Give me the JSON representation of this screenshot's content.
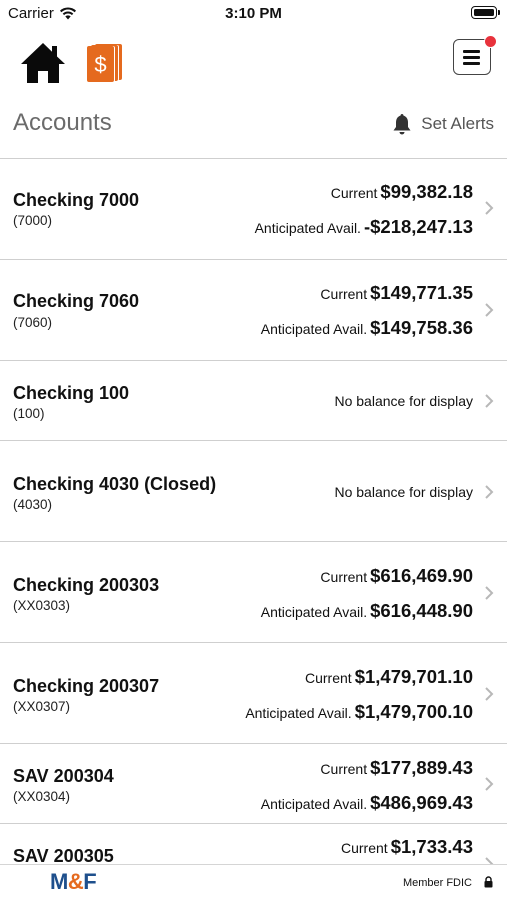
{
  "status_bar": {
    "carrier": "Carrier",
    "time": "3:10 PM"
  },
  "header": {
    "title": "Accounts",
    "set_alerts_label": "Set Alerts"
  },
  "accounts": [
    {
      "name": "Checking 7000",
      "number": "(7000)",
      "current_label": "Current",
      "current_value": "$99,382.18",
      "anticipated_label": "Anticipated Avail.",
      "anticipated_value": "-$218,247.13"
    },
    {
      "name": "Checking 7060",
      "number": "(7060)",
      "current_label": "Current",
      "current_value": "$149,771.35",
      "anticipated_label": "Anticipated Avail.",
      "anticipated_value": "$149,758.36"
    },
    {
      "name": "Checking 100",
      "number": "(100)",
      "no_balance": "No balance for display"
    },
    {
      "name": "Checking 4030 (Closed)",
      "number": "(4030)",
      "no_balance": "No balance for display"
    },
    {
      "name": "Checking 200303",
      "number": "(XX0303)",
      "current_label": "Current",
      "current_value": "$616,469.90",
      "anticipated_label": "Anticipated Avail.",
      "anticipated_value": "$616,448.90"
    },
    {
      "name": "Checking 200307",
      "number": "(XX0307)",
      "current_label": "Current",
      "current_value": "$1,479,701.10",
      "anticipated_label": "Anticipated Avail.",
      "anticipated_value": "$1,479,700.10"
    },
    {
      "name": "SAV 200304",
      "number": "(XX0304)",
      "current_label": "Current",
      "current_value": "$177,889.43",
      "anticipated_label": "Anticipated Avail.",
      "anticipated_value": "$486,969.43"
    },
    {
      "name": "SAV 200305",
      "current_label": "Current",
      "current_value": "$1,733.43"
    }
  ],
  "footer": {
    "logo_part1": "M",
    "logo_part2": "&",
    "logo_part3": "F",
    "member_fdic": "Member FDIC"
  },
  "colors": {
    "accent_orange": "#e56a1e",
    "brand_blue": "#1e4f8c",
    "notification_red": "#e8323c",
    "divider": "#cfcfcf"
  },
  "icons": [
    "wifi-icon",
    "battery-icon",
    "home-icon",
    "dollar-icon",
    "menu-icon",
    "bell-icon",
    "chevron-right-icon",
    "lock-icon"
  ]
}
